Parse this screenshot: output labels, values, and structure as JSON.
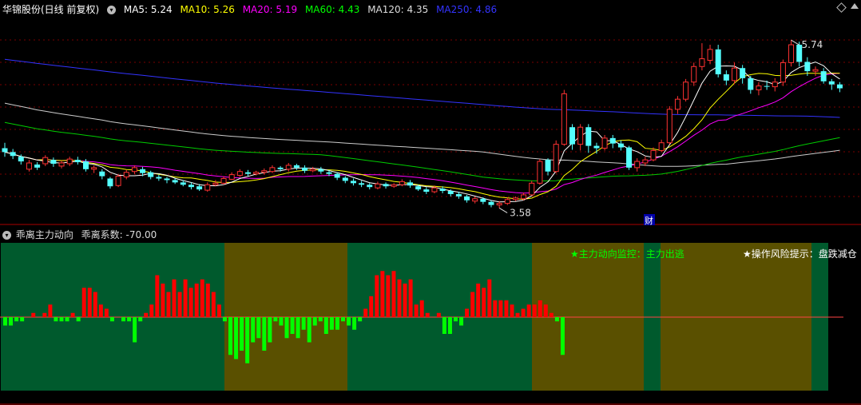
{
  "main_legend": {
    "stock": "华锦股份(日线 前复权)",
    "items": [
      {
        "label": "MA5: 5.24",
        "color": "#ffffff"
      },
      {
        "label": "MA10: 5.26",
        "color": "#ffff00"
      },
      {
        "label": "MA20: 5.19",
        "color": "#ff00ff"
      },
      {
        "label": "MA60: 4.43",
        "color": "#00ff00"
      },
      {
        "label": "MA120: 4.35",
        "color": "#dddddd"
      },
      {
        "label": "MA250: 4.86",
        "color": "#3333ff"
      }
    ]
  },
  "annotations": {
    "high_label": "5.74",
    "low_label": "3.58",
    "cai_label": "财"
  },
  "sub_legend": {
    "title": "乖离主力动向",
    "coef_label": "乖离系数: -70.00"
  },
  "sub_text": {
    "monitor": "★主力动向监控：主力出逃",
    "risk": "★操作风险提示：盘跌减仓"
  },
  "colors": {
    "up": "#ff3232",
    "down": "#54ffff",
    "green_band": "#005a2d",
    "olive_band": "#5a5000",
    "red_bar": "#ff0000",
    "green_bar": "#00ff00",
    "cai_bg": "#0000aa"
  },
  "chart_data": [
    {
      "type": "candlestick",
      "title": "华锦股份(日线 前复权)",
      "ylim": [
        3.4,
        6.05
      ],
      "moving_averages": [
        {
          "name": "MA5",
          "last": 5.24,
          "color": "#ffffff"
        },
        {
          "name": "MA10",
          "last": 5.26,
          "color": "#ffff00"
        },
        {
          "name": "MA20",
          "last": 5.19,
          "color": "#ff00ff"
        },
        {
          "name": "MA60",
          "last": 4.43,
          "color": "#00ff00"
        },
        {
          "name": "MA120",
          "last": 4.35,
          "color": "#dddddd"
        },
        {
          "name": "MA250",
          "last": 4.86,
          "color": "#3333ff"
        }
      ],
      "max_price_label": 5.74,
      "min_price_label": 3.58,
      "candles": [
        [
          4.35,
          4.3,
          4.42,
          4.24
        ],
        [
          4.3,
          4.25,
          4.34,
          4.21
        ],
        [
          4.24,
          4.18,
          4.27,
          4.14
        ],
        [
          4.08,
          4.16,
          4.2,
          4.05
        ],
        [
          4.14,
          4.1,
          4.17,
          4.07
        ],
        [
          4.15,
          4.23,
          4.26,
          4.12
        ],
        [
          4.2,
          4.15,
          4.23,
          4.11
        ],
        [
          4.12,
          4.16,
          4.19,
          4.09
        ],
        [
          4.15,
          4.21,
          4.24,
          4.12
        ],
        [
          4.2,
          4.17,
          4.24,
          4.14
        ],
        [
          4.18,
          4.08,
          4.21,
          4.05
        ],
        [
          4.08,
          4.1,
          4.13,
          4.03
        ],
        [
          4.05,
          3.99,
          4.08,
          3.95
        ],
        [
          3.96,
          3.86,
          3.98,
          3.83
        ],
        [
          3.87,
          3.99,
          4.02,
          3.85
        ],
        [
          3.98,
          4.04,
          4.07,
          3.95
        ],
        [
          4.05,
          4.1,
          4.13,
          4.02
        ],
        [
          4.08,
          4.03,
          4.11,
          3.99
        ],
        [
          4.04,
          3.98,
          4.06,
          3.95
        ],
        [
          3.98,
          3.96,
          4.01,
          3.93
        ],
        [
          3.96,
          3.94,
          3.98,
          3.9
        ],
        [
          3.94,
          3.91,
          3.96,
          3.89
        ],
        [
          3.91,
          3.88,
          3.94,
          3.86
        ],
        [
          3.88,
          3.85,
          3.91,
          3.82
        ],
        [
          3.86,
          3.82,
          3.89,
          3.8
        ],
        [
          3.81,
          3.88,
          3.91,
          3.79
        ],
        [
          3.88,
          3.9,
          3.94,
          3.86
        ],
        [
          3.9,
          3.96,
          3.99,
          3.88
        ],
        [
          3.95,
          4.01,
          4.04,
          3.94
        ],
        [
          4.0,
          4.05,
          4.08,
          3.98
        ],
        [
          4.04,
          4.02,
          4.07,
          3.99
        ],
        [
          4.02,
          4.04,
          4.06,
          4.0
        ],
        [
          4.04,
          4.06,
          4.09,
          4.01
        ],
        [
          4.05,
          4.1,
          4.13,
          4.03
        ],
        [
          4.1,
          4.08,
          4.12,
          4.05
        ],
        [
          4.08,
          4.13,
          4.16,
          4.05
        ],
        [
          4.13,
          4.1,
          4.15,
          4.07
        ],
        [
          4.1,
          4.06,
          4.13,
          4.03
        ],
        [
          4.06,
          4.08,
          4.11,
          4.04
        ],
        [
          4.08,
          4.05,
          4.11,
          4.02
        ],
        [
          4.04,
          4.02,
          4.07,
          3.99
        ],
        [
          4.02,
          3.97,
          4.04,
          3.94
        ],
        [
          3.97,
          3.93,
          3.99,
          3.9
        ],
        [
          3.93,
          3.9,
          3.96,
          3.87
        ],
        [
          3.9,
          3.88,
          3.93,
          3.85
        ],
        [
          3.88,
          3.85,
          3.9,
          3.82
        ],
        [
          3.84,
          3.89,
          3.92,
          3.82
        ],
        [
          3.89,
          3.86,
          3.91,
          3.83
        ],
        [
          3.86,
          3.88,
          3.9,
          3.84
        ],
        [
          3.88,
          3.92,
          3.95,
          3.86
        ],
        [
          3.91,
          3.87,
          3.94,
          3.84
        ],
        [
          3.86,
          3.82,
          3.88,
          3.8
        ],
        [
          3.82,
          3.79,
          3.85,
          3.76
        ],
        [
          3.79,
          3.84,
          3.87,
          3.77
        ],
        [
          3.83,
          3.8,
          3.86,
          3.77
        ],
        [
          3.8,
          3.76,
          3.82,
          3.73
        ],
        [
          3.76,
          3.73,
          3.79,
          3.7
        ],
        [
          3.73,
          3.68,
          3.75,
          3.65
        ],
        [
          3.67,
          3.7,
          3.73,
          3.64
        ],
        [
          3.7,
          3.66,
          3.72,
          3.63
        ],
        [
          3.66,
          3.62,
          3.68,
          3.59
        ],
        [
          3.62,
          3.64,
          3.67,
          3.58
        ],
        [
          3.64,
          3.69,
          3.72,
          3.62
        ],
        [
          3.69,
          3.71,
          3.73,
          3.67
        ],
        [
          3.7,
          3.75,
          3.78,
          3.68
        ],
        [
          3.75,
          3.9,
          3.93,
          3.74
        ],
        [
          3.9,
          4.18,
          4.21,
          3.88
        ],
        [
          4.2,
          4.05,
          4.22,
          4.0
        ],
        [
          4.05,
          4.4,
          4.45,
          4.03
        ],
        [
          4.4,
          5.05,
          5.1,
          4.38
        ],
        [
          4.62,
          4.4,
          4.66,
          4.33
        ],
        [
          4.4,
          4.62,
          4.66,
          4.32
        ],
        [
          4.62,
          4.38,
          4.66,
          4.29
        ],
        [
          4.38,
          4.35,
          4.42,
          4.28
        ],
        [
          4.35,
          4.48,
          4.52,
          4.32
        ],
        [
          4.48,
          4.41,
          4.52,
          4.35
        ],
        [
          4.41,
          4.36,
          4.45,
          4.32
        ],
        [
          4.36,
          4.1,
          4.38,
          4.07
        ],
        [
          4.1,
          4.18,
          4.22,
          4.05
        ],
        [
          4.16,
          4.2,
          4.24,
          4.12
        ],
        [
          4.2,
          4.32,
          4.36,
          4.18
        ],
        [
          4.32,
          4.42,
          4.46,
          4.3
        ],
        [
          4.42,
          4.85,
          4.89,
          4.4
        ],
        [
          4.85,
          4.98,
          5.02,
          4.79
        ],
        [
          4.98,
          5.2,
          5.24,
          4.95
        ],
        [
          5.2,
          5.4,
          5.45,
          5.15
        ],
        [
          5.4,
          5.5,
          5.7,
          5.35
        ],
        [
          5.48,
          5.62,
          5.68,
          5.43
        ],
        [
          5.62,
          5.3,
          5.68,
          5.26
        ],
        [
          5.3,
          5.22,
          5.35,
          5.16
        ],
        [
          5.22,
          5.38,
          5.45,
          5.18
        ],
        [
          5.38,
          5.25,
          5.42,
          5.18
        ],
        [
          5.25,
          5.1,
          5.28,
          5.05
        ],
        [
          5.1,
          5.15,
          5.2,
          5.03
        ],
        [
          5.15,
          5.14,
          5.22,
          5.1
        ],
        [
          5.14,
          5.2,
          5.25,
          5.08
        ],
        [
          5.2,
          5.45,
          5.49,
          5.15
        ],
        [
          5.45,
          5.68,
          5.74,
          5.4
        ],
        [
          5.68,
          5.46,
          5.72,
          5.4
        ],
        [
          5.46,
          5.34,
          5.52,
          5.28
        ],
        [
          5.34,
          5.36,
          5.4,
          5.28
        ],
        [
          5.34,
          5.21,
          5.38,
          5.18
        ],
        [
          5.21,
          5.17,
          5.24,
          5.1
        ],
        [
          5.17,
          5.12,
          5.2,
          5.07
        ]
      ]
    },
    {
      "type": "bar",
      "title": "乖离主力动向",
      "ylabel": "乖离系数",
      "last_value": -70.0,
      "values": [
        -10,
        -10,
        -5,
        -5,
        0,
        5,
        0,
        5,
        15,
        -5,
        -5,
        -5,
        5,
        -5,
        35,
        35,
        30,
        15,
        10,
        -5,
        0,
        -5,
        -5,
        -30,
        -5,
        5,
        15,
        50,
        40,
        30,
        45,
        30,
        45,
        35,
        40,
        45,
        40,
        30,
        15,
        -5,
        -45,
        -50,
        -40,
        -55,
        -30,
        -25,
        -40,
        -30,
        -5,
        -10,
        -25,
        -20,
        -25,
        -15,
        -30,
        -10,
        -5,
        -20,
        -15,
        -15,
        -5,
        -10,
        -15,
        -5,
        10,
        25,
        50,
        55,
        50,
        55,
        45,
        40,
        45,
        15,
        20,
        5,
        0,
        5,
        -20,
        -20,
        -5,
        -10,
        10,
        30,
        40,
        35,
        45,
        20,
        20,
        20,
        15,
        5,
        10,
        15,
        15,
        20,
        15,
        5,
        -5,
        -45
      ],
      "background_bands": [
        {
          "from": 0,
          "to": 40,
          "color": "green"
        },
        {
          "from": 40,
          "to": 62,
          "color": "olive"
        },
        {
          "from": 62,
          "to": 95,
          "color": "green"
        },
        {
          "from": 95,
          "to": 115,
          "color": "olive"
        },
        {
          "from": 115,
          "to": 118,
          "color": "green"
        },
        {
          "from": 118,
          "to": 145,
          "color": "olive"
        },
        {
          "from": 145,
          "to": 148,
          "color": "green"
        }
      ]
    }
  ]
}
